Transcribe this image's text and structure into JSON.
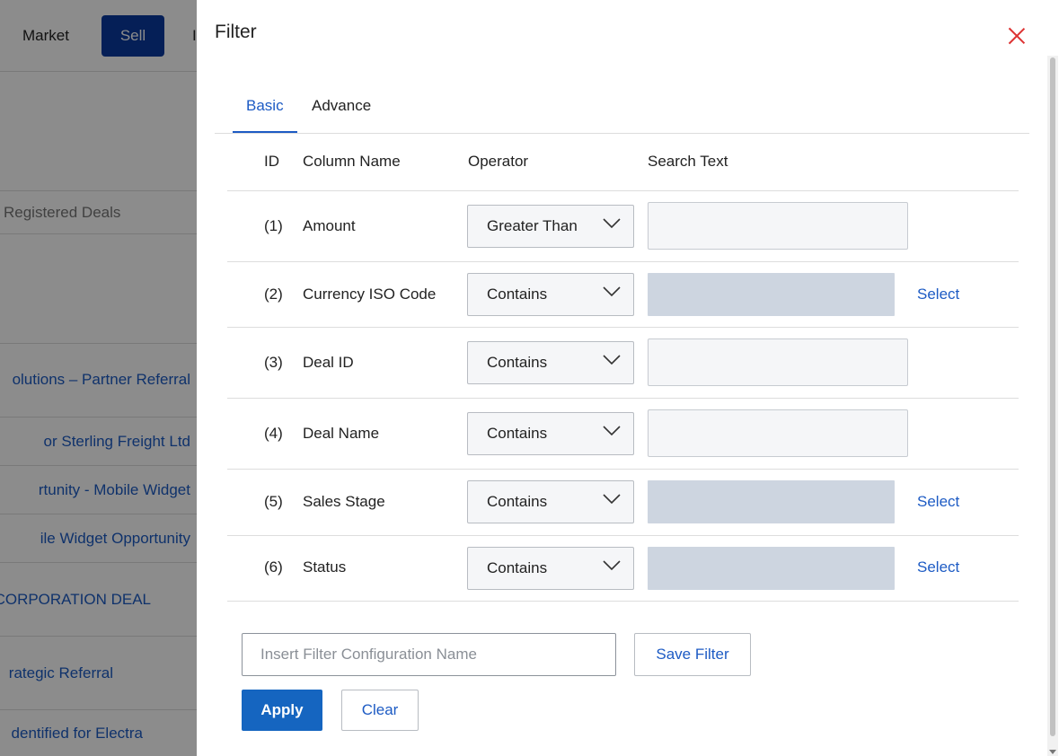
{
  "background": {
    "nav": {
      "market": "Market",
      "sell": "Sell",
      "third": "I"
    },
    "deals_header": "Registered Deals",
    "rows": [
      "olutions – Partner Referral",
      "or Sterling Freight Ltd",
      "rtunity - Mobile Widget",
      "ile Widget Opportunity",
      "CORPORATION DEAL",
      "rategic Referral",
      "dentified for Electra"
    ]
  },
  "filter": {
    "title": "Filter",
    "tabs": [
      {
        "label": "Basic",
        "active": true
      },
      {
        "label": "Advance",
        "active": false
      }
    ],
    "headers": {
      "id": "ID",
      "column_name": "Column Name",
      "operator": "Operator",
      "search_text": "Search Text"
    },
    "rows": [
      {
        "id": "(1)",
        "name": "Amount",
        "operator": "Greater Than",
        "search_value": "",
        "link": ""
      },
      {
        "id": "(2)",
        "name": "Currency ISO Code",
        "operator": "Contains",
        "search_value": "",
        "link": "Select"
      },
      {
        "id": "(3)",
        "name": "Deal ID",
        "operator": "Contains",
        "search_value": "",
        "link": ""
      },
      {
        "id": "(4)",
        "name": "Deal Name",
        "operator": "Contains",
        "search_value": "",
        "link": ""
      },
      {
        "id": "(5)",
        "name": "Sales Stage",
        "operator": "Contains",
        "search_value": "",
        "link": "Select"
      },
      {
        "id": "(6)",
        "name": "Status",
        "operator": "Contains",
        "search_value": "",
        "link": "Select"
      }
    ],
    "config_name": {
      "value": "",
      "placeholder": "Insert Filter Configuration Name"
    },
    "save_filter": "Save Filter",
    "apply": "Apply",
    "clear": "Clear"
  },
  "colors": {
    "accent": "#1d5bc4",
    "primary_button": "#1565c0",
    "sell_button": "#0a3a9e",
    "close": "#dd3333"
  }
}
